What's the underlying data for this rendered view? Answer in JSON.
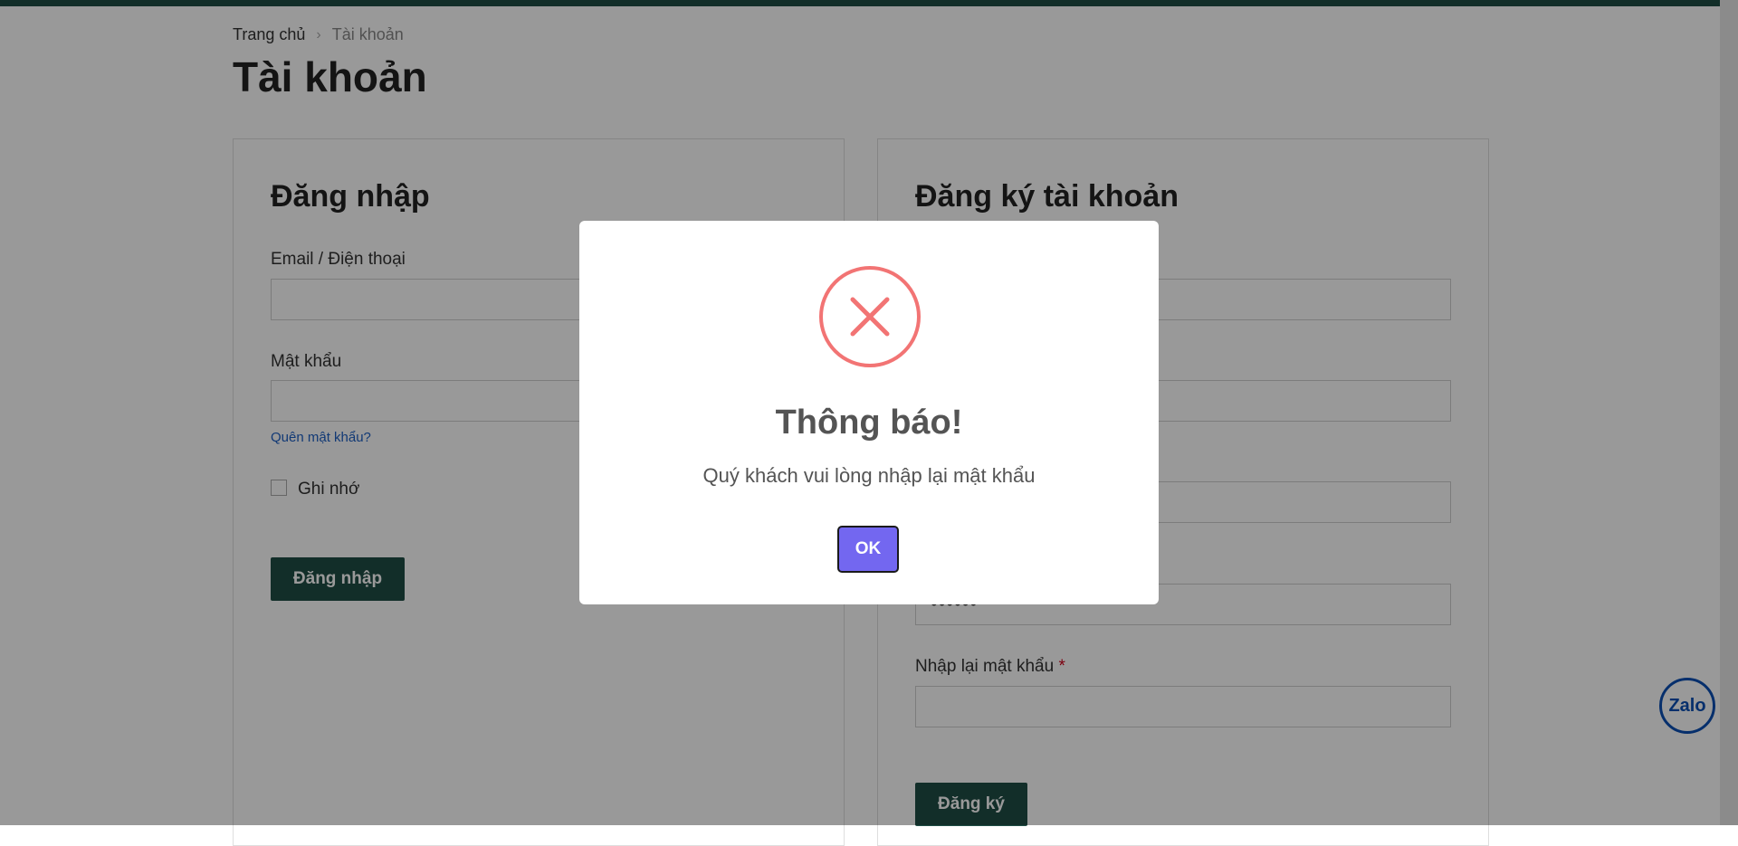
{
  "breadcrumb": {
    "home": "Trang chủ",
    "separator": "›",
    "current": "Tài khoản"
  },
  "page_title": "Tài khoản",
  "login": {
    "title": "Đăng nhập",
    "email_label": "Email / Điện thoại",
    "password_label": "Mật khẩu",
    "forgot_link": "Quên mật khẩu?",
    "remember_label": "Ghi nhớ",
    "submit_label": "Đăng nhập"
  },
  "register": {
    "title": "Đăng ký tài khoản",
    "password_value": "••••••",
    "confirm_label": "Nhập lại mật khẩu",
    "required_mark": "*",
    "submit_label": "Đăng ký"
  },
  "modal": {
    "icon": "error-x-icon",
    "title": "Thông báo!",
    "message": "Quý khách vui lòng nhập lại mật khẩu",
    "ok_label": "OK"
  },
  "zalo_label": "Zalo",
  "colors": {
    "brand": "#1f4d45",
    "ok_button": "#7367f0",
    "error": "#f27474",
    "link": "#1d5fc4"
  }
}
